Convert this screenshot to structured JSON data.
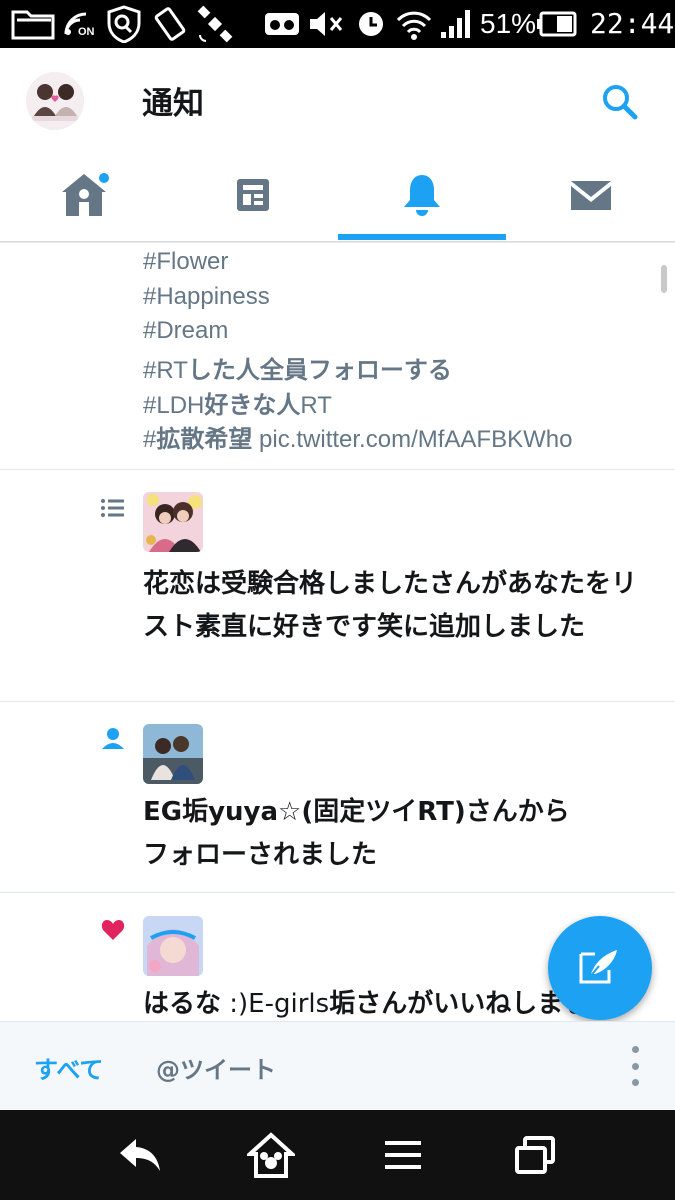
{
  "status_bar": {
    "on_label": "ON",
    "battery_percent": "51%",
    "time": "22:44"
  },
  "header": {
    "title": "通知"
  },
  "tabs": [
    {
      "name": "home",
      "icon": "home-icon",
      "has_badge": true
    },
    {
      "name": "moments",
      "icon": "moments-icon"
    },
    {
      "name": "notifications",
      "icon": "bell-icon",
      "active": true
    },
    {
      "name": "messages",
      "icon": "envelope-icon"
    }
  ],
  "feed": {
    "prev_tweet_hashtags": [
      {
        "a": "#Flower",
        "b": "",
        "c": ""
      },
      {
        "a": "#Happiness",
        "b": "",
        "c": ""
      },
      {
        "a": "#Dream",
        "b": "",
        "c": ""
      },
      {
        "a": "#RT",
        "b": "した人全員フォローする",
        "c": ""
      },
      {
        "a": "#LDH",
        "b": "好きな人",
        "c": "RT"
      },
      {
        "a": "#",
        "b": "拡散希望",
        "c": " pic.twitter.com/MfAAFBKWho"
      }
    ],
    "notifications": [
      {
        "type": "list",
        "icon": "list-icon",
        "text": "花恋は受験合格しましたさんがあなたをリスト素直に好きです笑に追加しました"
      },
      {
        "type": "follow",
        "icon": "person-icon",
        "text_line1": "EG垢yuya☆(固定ツイRT)さんから",
        "text_line2": "フォローされました"
      },
      {
        "type": "like",
        "icon": "heart-icon",
        "name_a": "はるな",
        "name_b": " :)E-girls",
        "text_rest": "垢さんがいいねしました"
      }
    ]
  },
  "filter_bar": {
    "all_label": "すべて",
    "mentions_label": "@ツイート"
  },
  "colors": {
    "accent": "#1da1f2",
    "like": "#e0245e",
    "secondary_text": "#657786",
    "icon_gray": "#657786"
  }
}
